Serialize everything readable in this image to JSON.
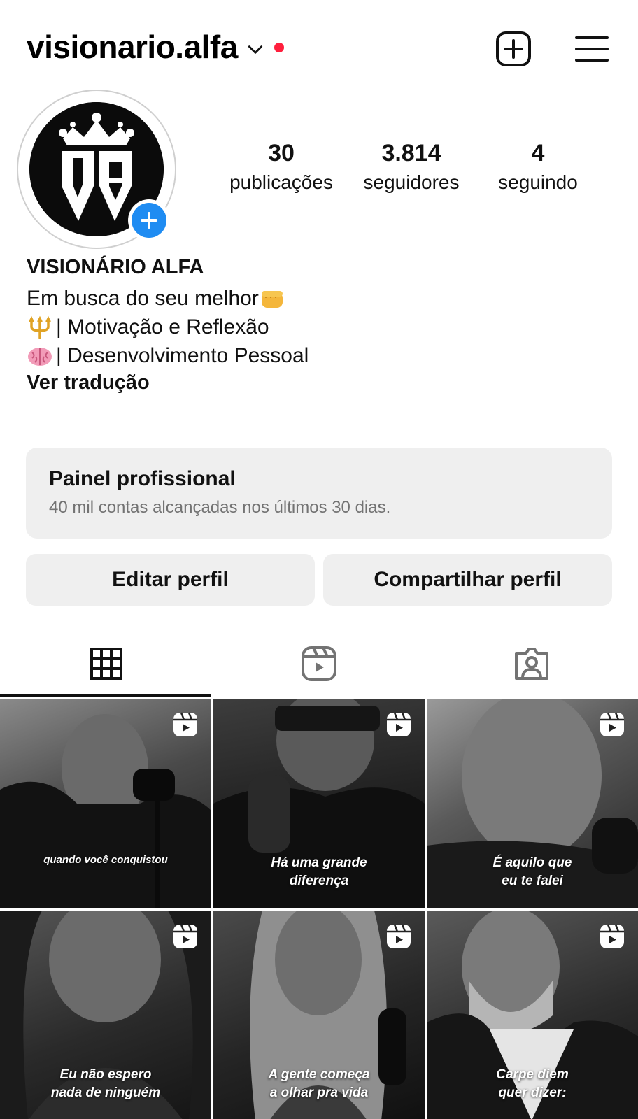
{
  "header": {
    "username": "visionario.alfa",
    "notification_dot_color": "#ff1f3d",
    "icons": [
      "chevron-down-icon",
      "new-post-icon",
      "menu-icon"
    ]
  },
  "profile": {
    "avatar_text": "VA",
    "avatar_icon": "crown-icon",
    "add_story_color": "#1f8cf2",
    "stats": {
      "posts": {
        "value": "30",
        "label": "publicações"
      },
      "followers": {
        "value": "3.814",
        "label": "seguidores"
      },
      "following": {
        "value": "4",
        "label": "seguindo"
      }
    }
  },
  "bio": {
    "name": "VISIONÁRIO ALFA",
    "line1": "Em busca do seu melhor",
    "line1_emoji": "fist-icon",
    "line2": "| Motivação e Reflexão",
    "line2_emoji": "trident-icon",
    "line3": "| Desenvolvimento Pessoal",
    "line3_emoji": "brain-icon",
    "translate": "Ver tradução"
  },
  "pro_dashboard": {
    "title": "Painel profissional",
    "subtitle": "40 mil contas alcançadas nos últimos 30 dias."
  },
  "actions": {
    "edit": "Editar perfil",
    "share": "Compartilhar perfil"
  },
  "tabs": [
    "grid-icon",
    "reels-icon",
    "tagged-icon"
  ],
  "posts": [
    {
      "caption": "quando você conquistou"
    },
    {
      "caption_l1": "Há uma grande",
      "caption_l2": "diferença"
    },
    {
      "caption_l1": "É aquilo que",
      "caption_l2": "eu te falei"
    },
    {
      "caption_l1": "Eu não espero",
      "caption_l2": "nada de ninguém"
    },
    {
      "caption_l1": "A gente começa",
      "caption_l2": "a olhar pra vida"
    },
    {
      "caption_l1": "Carpe diem",
      "caption_l2": "quer dizer:"
    }
  ]
}
